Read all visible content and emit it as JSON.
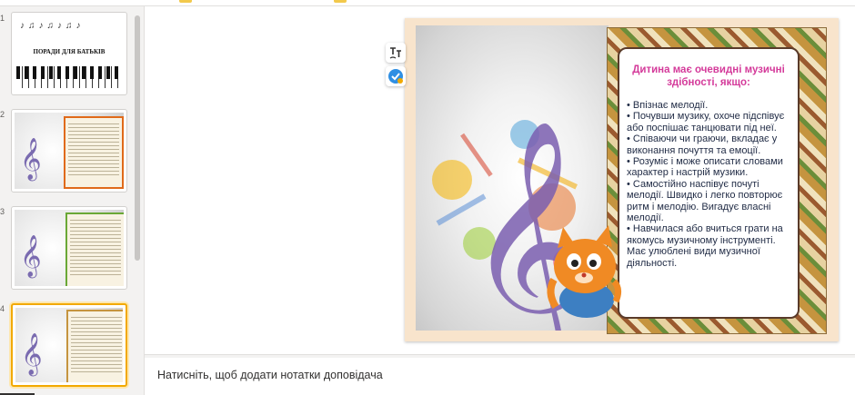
{
  "thumbnails": [
    {
      "number": "1",
      "title": "ПОРАДИ ДЛЯ БАТЬКІВ",
      "selected": false
    },
    {
      "number": "2",
      "selected": false
    },
    {
      "number": "3",
      "selected": false
    },
    {
      "number": "4",
      "selected": true
    }
  ],
  "slide": {
    "heading": "Дитина має очевидні музичні здібності, якщо:",
    "body": "• Впізнає мелодії.\n• Почувши музику, охоче підспівує або поспішає танцювати під неї.\n• Співаючи чи граючи, вкладає у виконання почуття та емоції.\n• Розуміє і може описати словами характер і настрій музики.\n• Самостійно наспівує почуті мелодії. Швидко і легко повторює ритм і мелодію. Вигадує власні мелодії.\n• Навчилася або вчиться грати на якомусь музичному інструменті. Має улюблені види музичної діяльності."
  },
  "side_buttons": {
    "translate_icon": "translate-icon",
    "check_icon": "check-badge-icon"
  },
  "notes": {
    "placeholder": "Натисніть, щоб додати нотатки доповідача"
  },
  "colors": {
    "accent": "#f2a900",
    "heading": "#d43a9a",
    "text": "#1f2a44"
  }
}
